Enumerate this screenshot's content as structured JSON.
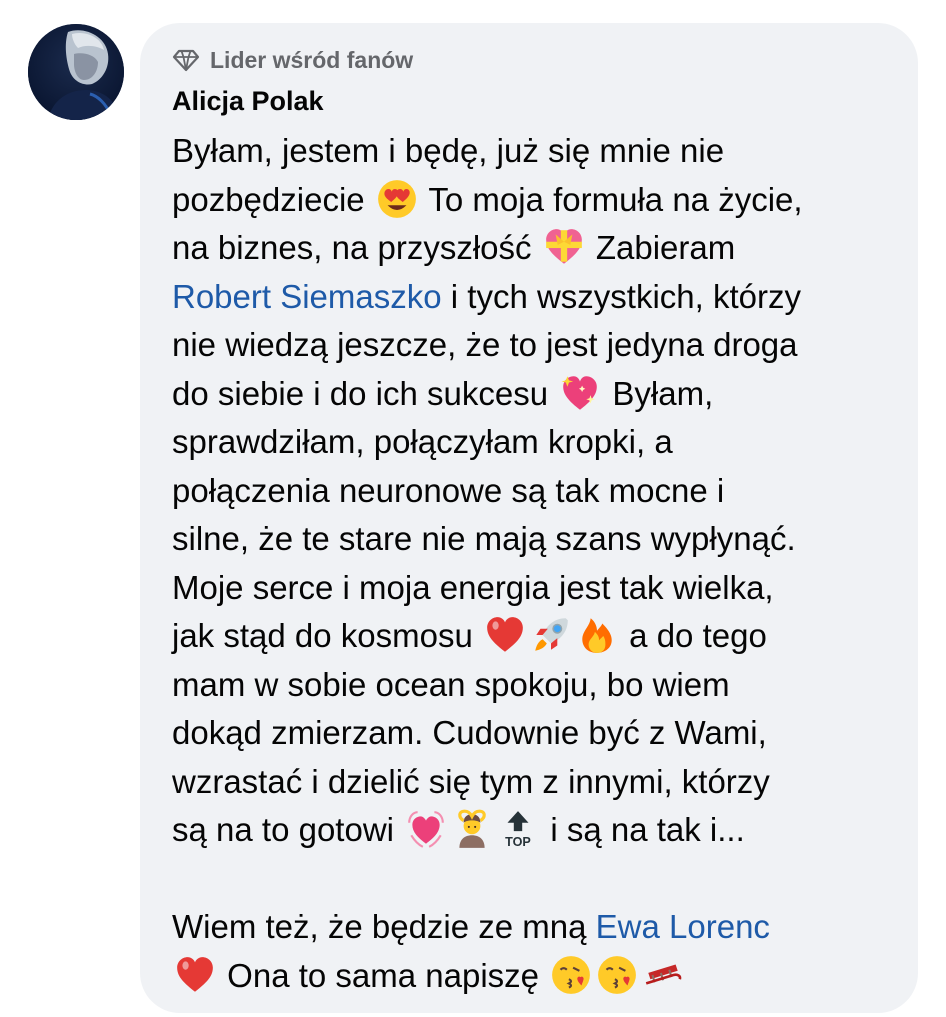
{
  "comment": {
    "badge_label": "Lider wśród fanów",
    "author": "Alicja Polak",
    "lines": {
      "l1": "Byłam, jestem i będę, już się mnie nie",
      "l2a": "pozbędziecie",
      "l2b": "To moja formuła na życie,",
      "l3a": "na biznes, na przyszłość",
      "l3b": "Zabieram",
      "l4_mention": "Robert Siemaszko",
      "l4b": " i tych wszystkich, którzy",
      "l5": "nie wiedzą jeszcze, że to jest jedyna droga",
      "l6a": "do siebie i do ich sukcesu",
      "l6b": "Byłam,",
      "l7": "sprawdziłam, połączyłam kropki, a",
      "l8": "połączenia neuronowe są tak mocne i",
      "l9": "silne, że te stare nie mają szans wypłynąć.",
      "l10": "Moje serce i moja energia jest tak wielka,",
      "l11a": "jak stąd do kosmosu",
      "l11b": "a do tego",
      "l12": "mam w sobie ocean spokoju, bo wiem",
      "l13": "dokąd zmierzam. Cudownie być z Wami,",
      "l14": "wzrastać i dzielić się tym z innymi, którzy",
      "l15a": "są na to gotowi",
      "l15b": "i są na tak i...",
      "l16a": "Wiem też, że będzie ze mną ",
      "l16_mention": "Ewa Lorenc",
      "l17b": "Ona to sama napiszę"
    },
    "emoji_names": [
      "heart-eyes-emoji",
      "heart-with-ribbon-emoji",
      "sparkling-heart-emoji",
      "red-heart-emoji",
      "rocket-emoji",
      "fire-emoji",
      "growing-heart-emoji",
      "person-gesturing-ok-emoji",
      "top-arrow-emoji",
      "red-heart-emoji",
      "face-blowing-kiss-emoji",
      "face-blowing-kiss-emoji",
      "sled-emoji"
    ]
  },
  "colors": {
    "bubble_background": "#f0f2f5",
    "mention_link": "#1e5aa8",
    "badge_gray": "#65676b",
    "text": "#050505"
  }
}
